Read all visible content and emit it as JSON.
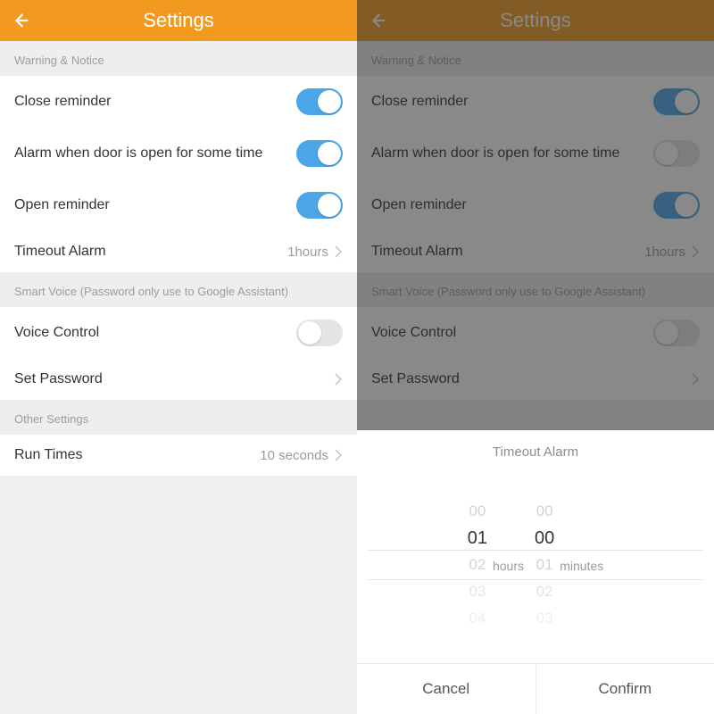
{
  "header": {
    "title": "Settings"
  },
  "sections": {
    "warning_label": "Warning & Notice",
    "smart_voice_label": "Smart Voice (Password only use to Google Assistant)",
    "other_label": "Other Settings"
  },
  "rows": {
    "close_reminder": "Close reminder",
    "alarm_open": "Alarm when door is open for some time",
    "open_reminder": "Open reminder",
    "timeout_alarm": "Timeout Alarm",
    "timeout_value": "1hours",
    "voice_control": "Voice Control",
    "set_password": "Set Password",
    "run_times": "Run Times",
    "run_times_value": "10 seconds"
  },
  "modal": {
    "title": "Timeout Alarm",
    "hours_unit": "hours",
    "minutes_unit": "minutes",
    "cancel": "Cancel",
    "confirm": "Confirm",
    "hours": {
      "prev": "00",
      "sel": "01",
      "n1": "02",
      "n2": "03",
      "n3": "04"
    },
    "minutes": {
      "prev": "00",
      "sel": "00",
      "n1": "01",
      "n2": "02",
      "n3": "03"
    }
  },
  "right_pane_toggle_alarm_open_on": false
}
